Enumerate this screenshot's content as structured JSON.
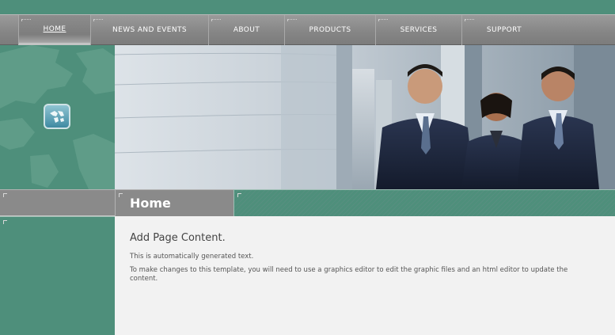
{
  "nav": {
    "items": [
      {
        "label": "HOME",
        "active": true
      },
      {
        "label": "NEWS AND EVENTS",
        "active": false
      },
      {
        "label": "ABOUT",
        "active": false
      },
      {
        "label": "PRODUCTS",
        "active": false
      },
      {
        "label": "SERVICES",
        "active": false
      },
      {
        "label": "SUPPORT",
        "active": false
      }
    ]
  },
  "icons": {
    "globe": "globe-icon"
  },
  "page": {
    "title": "Home"
  },
  "content": {
    "heading": "Add Page Content.",
    "paragraphs": [
      "This is automatically generated text.",
      "To make changes to this template, you will need to use a graphics editor to edit the graphic files and an html editor to update the content."
    ]
  },
  "colors": {
    "accent_green": "#4e8f7b",
    "nav_gray": "#8a8a8a",
    "content_bg": "#f2f2f2"
  }
}
